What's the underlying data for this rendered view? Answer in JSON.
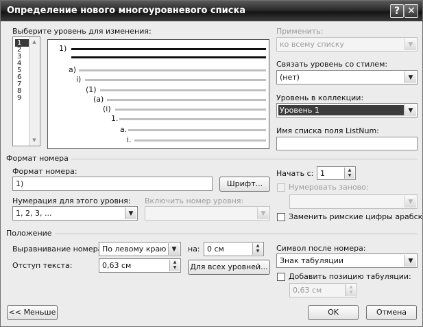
{
  "window": {
    "title": "Определение нового многоуровневого списка",
    "help": "?",
    "close": "✕"
  },
  "level_select": {
    "label": "Выберите уровень для изменения:",
    "levels": [
      "1",
      "2",
      "3",
      "4",
      "5",
      "6",
      "7",
      "8",
      "9"
    ],
    "selected": "1"
  },
  "preview": {
    "markers": [
      "1)",
      "a)",
      "i)",
      "(1)",
      "(a)",
      "(i)",
      "1.",
      "a.",
      "i."
    ]
  },
  "right": {
    "apply_label": "Применить:",
    "apply_value": "ко всему списку",
    "link_style_label": "Связать уровень со стилем:",
    "link_style_value": "(нет)",
    "gallery_level_label": "Уровень в коллекции:",
    "gallery_level_value": "Уровень 1",
    "listnum_label": "Имя списка поля ListNum:",
    "listnum_value": ""
  },
  "number_format": {
    "group_label": "Формат номера",
    "format_label": "Формат номера:",
    "format_value": "1)",
    "font_button": "Шрифт...",
    "numbering_label": "Нумерация для этого уровня:",
    "numbering_value": "1, 2, 3, ...",
    "include_label": "Включить номер уровня:",
    "start_label": "Начать с:",
    "start_value": "1",
    "restart_label": "Нумеровать заново:",
    "legal_label": "Заменить римские цифры арабскими"
  },
  "position": {
    "group_label": "Положение",
    "align_label": "Выравнивание номера:",
    "align_value": "По левому краю",
    "at_label": "на:",
    "at_value": "0 см",
    "indent_label": "Отступ текста:",
    "indent_value": "0,63 см",
    "all_levels_button": "Для всех уровней...",
    "follow_label": "Символ после номера:",
    "follow_value": "Знак табуляции",
    "add_tab_label": "Добавить позицию табуляции:",
    "tab_value": "0,63 см"
  },
  "footer": {
    "less_button": "<< Меньше",
    "ok_button": "OK",
    "cancel_button": "Отмена"
  }
}
